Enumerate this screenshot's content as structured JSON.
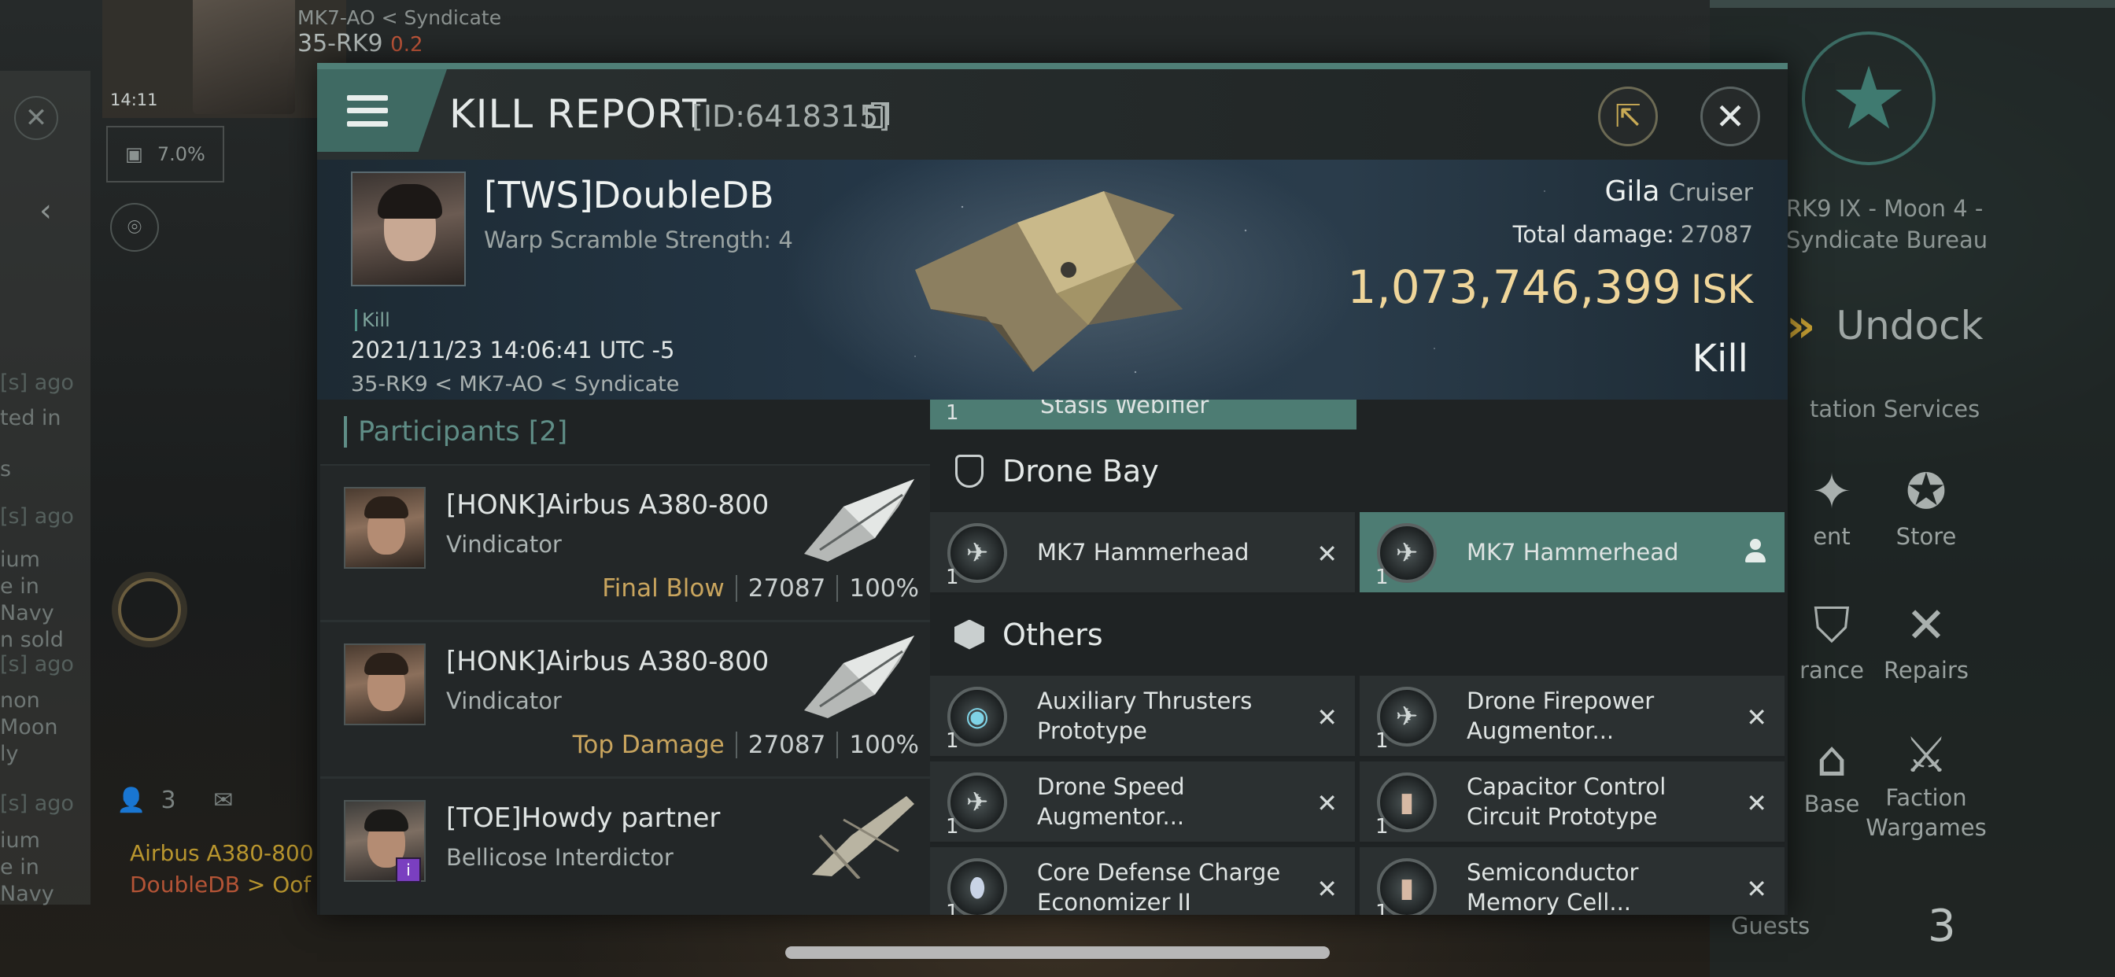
{
  "background": {
    "system_path": "MK7-AO",
    "system_region": "Syndicate",
    "system_name": "35-RK9",
    "security": "0.2",
    "clock": "14:11",
    "cargo_percent": "7.0%",
    "left_feed": [
      "[s] ago",
      "ted in",
      "s",
      "[s] ago",
      "ium",
      "e in",
      "Navy",
      "n sold",
      "[s] ago",
      "non",
      "Moon",
      "ly",
      "[s] ago",
      "ium",
      "e in",
      "Navy"
    ],
    "people_count": "3",
    "feed_line_1": "Airbus A380-800",
    "feed_line_2a": "DoubleDB",
    "feed_line_2b": " > Oof",
    "station_line_1": "RK9 IX - Moon 4 -",
    "station_line_2": "Syndicate Bureau",
    "undock_label": "Undock",
    "station_services_label": "tation Services",
    "services": [
      {
        "label": "ent",
        "icon": "sparkle-icon"
      },
      {
        "label": "Store",
        "icon": "store-icon"
      },
      {
        "label": "rance",
        "icon": "insurance-icon"
      },
      {
        "label": "Repairs",
        "icon": "wrench-icon"
      },
      {
        "label": "Base",
        "icon": "base-icon"
      },
      {
        "label": "Faction Wargames",
        "icon": "crossed-flags-icon"
      }
    ],
    "guests_label": "Guests",
    "guests_count": "3"
  },
  "modal": {
    "title": "KILL REPORT",
    "id_text": "[ID:6418315]",
    "victim": {
      "name": "[TWS]DoubleDB",
      "warp_scramble": "Warp Scramble Strength: 4",
      "kill_tag": "Kill",
      "datetime": "2021/11/23 14:06:41 UTC -5",
      "location": "35-RK9 < MK7-AO < Syndicate",
      "ship_name": "Gila",
      "ship_class": "Cruiser",
      "total_damage_label": "Total damage:",
      "total_damage": "27087",
      "isk_value": "1,073,746,399",
      "isk_unit": "ISK",
      "result": "Kill"
    },
    "participants": {
      "label": "Participants",
      "count": "[2]",
      "rows": [
        {
          "name": "[HONK]Airbus A380-800",
          "ship": "Vindicator",
          "tag": "Final Blow",
          "damage": "27087",
          "percent": "100%"
        },
        {
          "name": "[HONK]Airbus A380-800",
          "ship": "Vindicator",
          "tag": "Top Damage",
          "damage": "27087",
          "percent": "100%"
        },
        {
          "name": "[TOE]Howdy partner",
          "ship": "Bellicose Interdictor",
          "tag": "",
          "damage": "",
          "percent": ""
        }
      ]
    },
    "items": {
      "partial_item": {
        "qty": "1",
        "name": "Stasis Webifier"
      },
      "drone_bay_label": "Drone Bay",
      "drones": [
        {
          "qty": "1",
          "name": "MK7  Hammerhead",
          "status": "destroyed"
        },
        {
          "qty": "1",
          "name": "MK7  Hammerhead",
          "status": "dropped"
        }
      ],
      "others_label": "Others",
      "others": [
        {
          "qty": "1",
          "name": "Auxiliary Thrusters Prototype",
          "status": "destroyed"
        },
        {
          "qty": "1",
          "name": "Drone Firepower Augmentor...",
          "status": "destroyed"
        },
        {
          "qty": "1",
          "name": "Drone Speed Augmentor...",
          "status": "destroyed"
        },
        {
          "qty": "1",
          "name": "Capacitor Control Circuit Prototype",
          "status": "destroyed"
        },
        {
          "qty": "1",
          "name": "Core Defense Charge Economizer II",
          "status": "destroyed"
        },
        {
          "qty": "1",
          "name": "Semiconductor Memory Cell...",
          "status": "destroyed"
        }
      ],
      "destroyed_glyph": "✕"
    }
  }
}
